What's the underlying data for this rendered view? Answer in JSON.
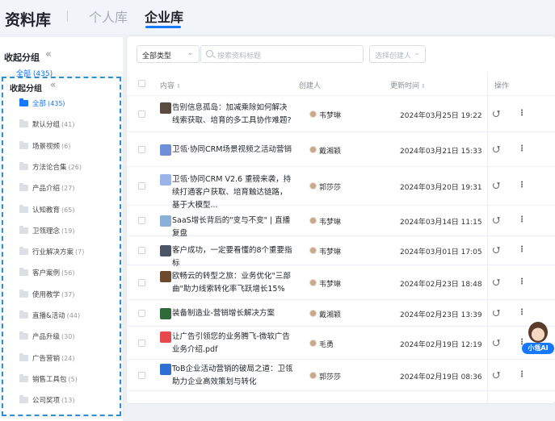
{
  "header": {
    "title": "资料库",
    "tabs": [
      {
        "label": "个人库",
        "active": false
      },
      {
        "label": "企业库",
        "active": true
      }
    ]
  },
  "background_sidebar": {
    "collapse_label": "收起分组",
    "all_label": "全部",
    "all_count": "(435)"
  },
  "filters": {
    "type_value": "全部类型",
    "search_placeholder": "搜索资料标题",
    "creator_placeholder": "选择创建人"
  },
  "table": {
    "columns": {
      "content": "内容",
      "creator": "创建人",
      "updated": "更新时间",
      "actions": "操作"
    },
    "rows": [
      {
        "title": "告别信息孤岛：加减乘除如何解决线索获取、培育的多工具协作难题?",
        "creator": "韦梦琳",
        "time": "2024年03月25日 19:22",
        "thumb_color": "#5a4a3f"
      },
      {
        "title": "卫瓴·协同CRM场景视频之活动营销",
        "creator": "戴湘颖",
        "time": "2024年03月21日 15:33",
        "thumb_color": "#6f8fd6"
      },
      {
        "title": "卫瓴·协同CRM V2.6 重磅来袭，持续打通客户获取、培育触达链路，基于大模型...",
        "creator": "郭莎莎",
        "time": "2024年03月20日 19:31",
        "thumb_color": "#9ab4ea"
      },
      {
        "title": "SaaS增长背后的\"变与不变\" | 直播复盘",
        "creator": "韦梦琳",
        "time": "2024年03月14日 11:15",
        "thumb_color": "#8bb0d8"
      },
      {
        "title": "客户成功，一定要看懂的8个重要指标",
        "creator": "韦梦琳",
        "time": "2024年03月01日 17:05",
        "thumb_color": "#4b5566"
      },
      {
        "title": "欧畅云的转型之旅：业务优化\"三部曲\"助力线索转化率飞跃增长15%",
        "creator": "韦梦琳",
        "time": "2024年02月23日 18:48",
        "thumb_color": "#6b4a2f"
      },
      {
        "title": "装备制造业-营销增长解决方案",
        "creator": "戴湘颖",
        "time": "2024年02月23日 13:39",
        "thumb_color": "#2f6b3a"
      },
      {
        "title": "让广告引领您的业务腾飞-微软广告业务介绍.pdf",
        "creator": "毛勇",
        "time": "2024年02月19日 12:19",
        "thumb_color": "#e5484d"
      },
      {
        "title": "ToB企业活动营销的破局之道：卫瓴助力企业高效策划与转化",
        "creator": "郭莎莎",
        "time": "2024年02月19日 08:36",
        "thumb_color": "#2e6fd1"
      }
    ]
  },
  "overlay_sidebar": {
    "title": "收起分组",
    "items": [
      {
        "label": "全部",
        "count": "(435)",
        "active": true
      },
      {
        "label": "默认分组",
        "count": "(41)"
      },
      {
        "label": "场景视频",
        "count": "(6)"
      },
      {
        "label": "方法论合集",
        "count": "(26)"
      },
      {
        "label": "产品介绍",
        "count": "(27)"
      },
      {
        "label": "认知教育",
        "count": "(65)"
      },
      {
        "label": "卫瓴理念",
        "count": "(19)"
      },
      {
        "label": "行业解决方案",
        "count": "(7)"
      },
      {
        "label": "客户案例",
        "count": "(56)"
      },
      {
        "label": "使用教学",
        "count": "(37)"
      },
      {
        "label": "直播&活动",
        "count": "(44)"
      },
      {
        "label": "产品升级",
        "count": "(30)"
      },
      {
        "label": "广告营销",
        "count": "(24)"
      },
      {
        "label": "销售工具包",
        "count": "(5)"
      },
      {
        "label": "公司奖项",
        "count": "(13)"
      }
    ]
  },
  "assistant": {
    "label": "小瓴AI"
  }
}
